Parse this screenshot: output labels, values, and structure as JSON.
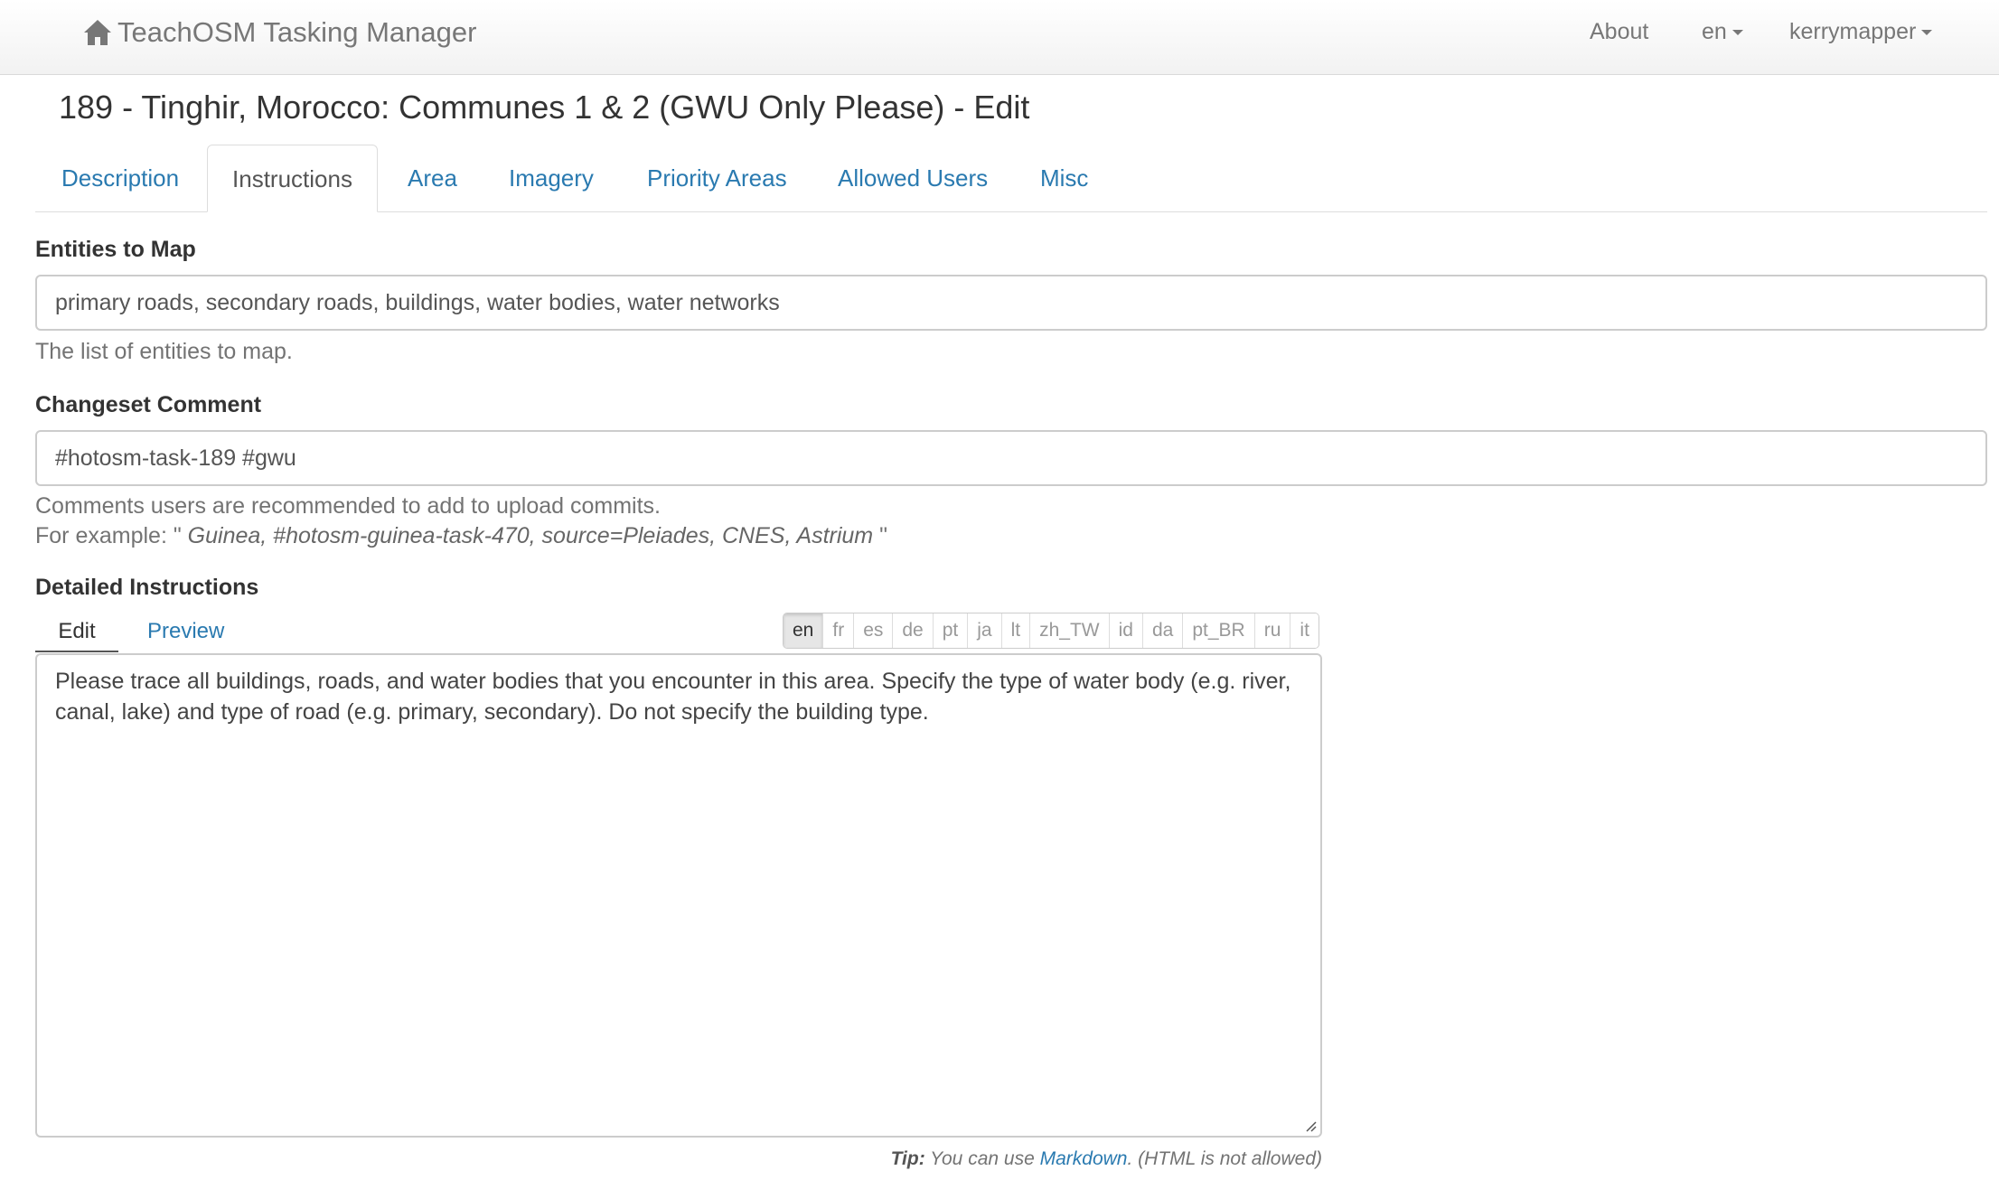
{
  "navbar": {
    "brand": "TeachOSM Tasking Manager",
    "brand_icon": "home-icon",
    "about": "About",
    "language": "en",
    "user": "kerrymapper"
  },
  "page": {
    "title": "189 - Tinghir, Morocco: Communes 1 & 2 (GWU Only Please) - Edit"
  },
  "tabs": [
    {
      "label": "Description",
      "active": false
    },
    {
      "label": "Instructions",
      "active": true
    },
    {
      "label": "Area",
      "active": false
    },
    {
      "label": "Imagery",
      "active": false
    },
    {
      "label": "Priority Areas",
      "active": false
    },
    {
      "label": "Allowed Users",
      "active": false
    },
    {
      "label": "Misc",
      "active": false
    }
  ],
  "entities": {
    "label": "Entities to Map",
    "value": "primary roads, secondary roads, buildings, water bodies, water networks",
    "help": "The list of entities to map."
  },
  "changeset": {
    "label": "Changeset Comment",
    "value": "#hotosm-task-189 #gwu",
    "help_line1": "Comments users are recommended to add to upload commits.",
    "help_prefix": "For example: \"",
    "help_example": " Guinea, #hotosm-guinea-task-470, source=Pleiades, CNES, Astrium ",
    "help_suffix": "\""
  },
  "instructions": {
    "label": "Detailed Instructions",
    "edit_tab": "Edit",
    "preview_tab": "Preview",
    "languages": [
      "en",
      "fr",
      "es",
      "de",
      "pt",
      "ja",
      "lt",
      "zh_TW",
      "id",
      "da",
      "pt_BR",
      "ru",
      "it"
    ],
    "active_language": "en",
    "text": "Please trace all buildings, roads, and water bodies that you encounter in this area. Specify the type of water body (e.g. river, canal, lake) and type of road (e.g. primary, secondary). Do not specify the building type.",
    "tip_label": "Tip:",
    "tip_text": " You can use ",
    "tip_link": "Markdown",
    "tip_suffix": ". (HTML is not allowed)"
  },
  "colors": {
    "link": "#2a7ab0",
    "navbar_text": "#777777"
  }
}
